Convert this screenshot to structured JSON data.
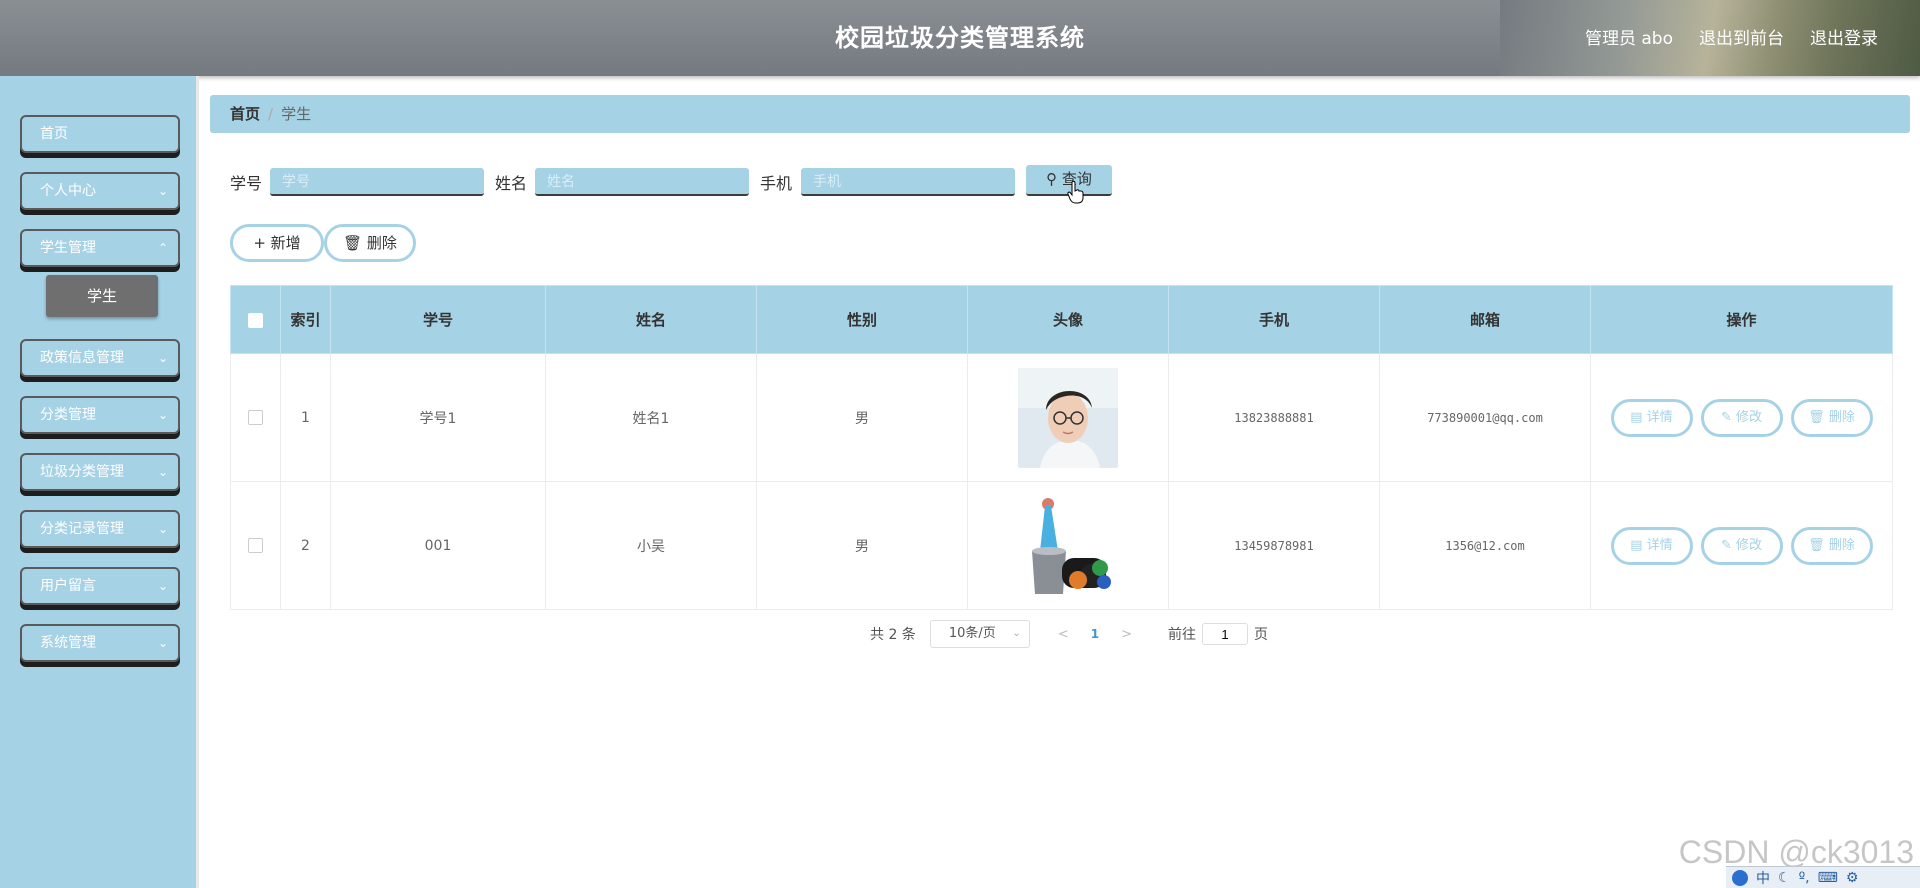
{
  "header": {
    "title": "校园垃圾分类管理系统",
    "user_label": "管理员 abo",
    "to_front_label": "退出到前台",
    "logout_label": "退出登录"
  },
  "sidebar": {
    "items": [
      {
        "label": "首页",
        "has_chevron": false
      },
      {
        "label": "个人中心",
        "has_chevron": true
      },
      {
        "label": "学生管理",
        "has_chevron": true
      },
      {
        "label": "政策信息管理",
        "has_chevron": true
      },
      {
        "label": "分类管理",
        "has_chevron": true
      },
      {
        "label": "垃圾分类管理",
        "has_chevron": true
      },
      {
        "label": "分类记录管理",
        "has_chevron": true
      },
      {
        "label": "用户留言",
        "has_chevron": true
      },
      {
        "label": "系统管理",
        "has_chevron": true
      }
    ],
    "active_sub_item": "学生"
  },
  "breadcrumb": {
    "home": "首页",
    "current": "学生"
  },
  "search": {
    "fields": [
      {
        "label": "学号",
        "placeholder": "学号"
      },
      {
        "label": "姓名",
        "placeholder": "姓名"
      },
      {
        "label": "手机",
        "placeholder": "手机"
      }
    ],
    "query_label": "查询"
  },
  "actions": {
    "add_label": "新增",
    "delete_label": "删除"
  },
  "table": {
    "columns": [
      "索引",
      "学号",
      "姓名",
      "性别",
      "头像",
      "手机",
      "邮箱",
      "操作"
    ],
    "rows": [
      {
        "index": "1",
        "student_no": "学号1",
        "name": "姓名1",
        "gender": "男",
        "avatar": "portrait-photo",
        "phone": "13823888881",
        "email": "773890001@qq.com"
      },
      {
        "index": "2",
        "student_no": "001",
        "name": "小吴",
        "gender": "男",
        "avatar": "trash-bags-photo",
        "phone": "13459878981",
        "email": "1356@12.com"
      }
    ],
    "row_actions": {
      "detail": "详情",
      "edit": "修改",
      "delete": "删除"
    }
  },
  "pagination": {
    "total_text": "共 2 条",
    "page_size": "10条/页",
    "current_page": "1",
    "goto_prefix": "前往",
    "goto_value": "1",
    "goto_suffix": "页"
  },
  "watermark": "CSDN @ck3013",
  "ime": {
    "lang": "中"
  },
  "colors": {
    "accent": "#a6d2e6",
    "active_sub": "#6f6f6f",
    "header": "#7d8287"
  }
}
